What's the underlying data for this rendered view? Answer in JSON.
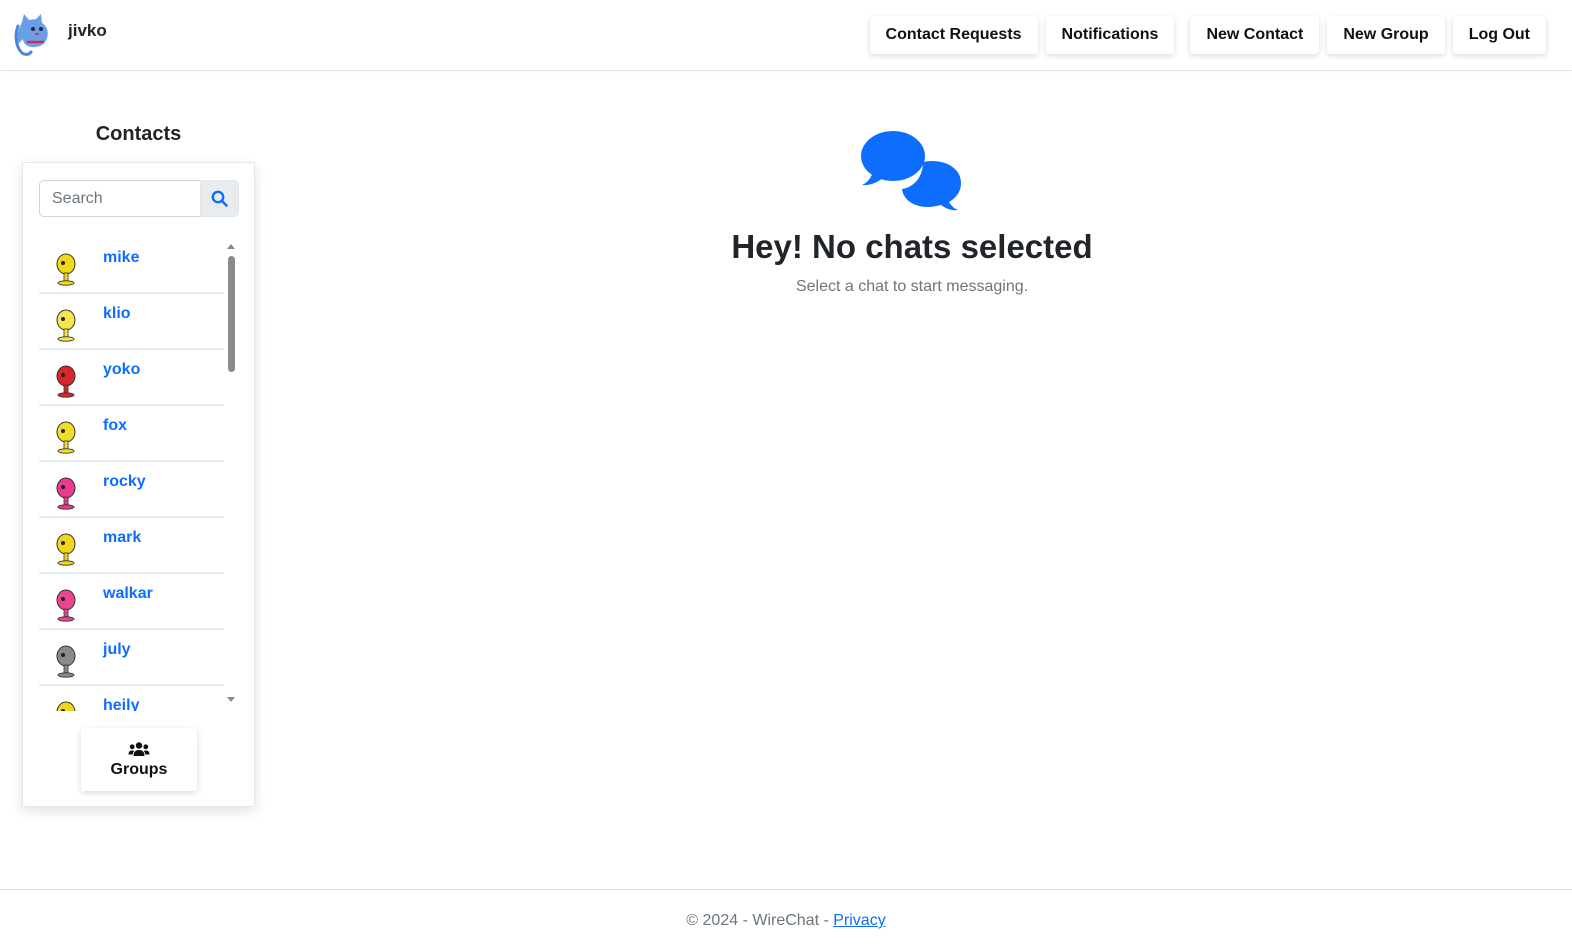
{
  "header": {
    "username": "jivko",
    "logo_icon": "blue-cat-icon",
    "nav": [
      {
        "label": "Contact Requests"
      },
      {
        "label": "Notifications"
      },
      {
        "label": "New Contact"
      },
      {
        "label": "New Group"
      },
      {
        "label": "Log Out"
      }
    ]
  },
  "sidebar": {
    "title": "Contacts",
    "search": {
      "placeholder": "Search",
      "value": "",
      "icon": "search-icon"
    },
    "contacts": [
      {
        "name": "mike",
        "avatar_icon": "yellow-robot-avatar-icon",
        "avatar_color": "#f2d81a"
      },
      {
        "name": "klio",
        "avatar_icon": "yellow-robot-avatar-icon",
        "avatar_color": "#f5e64a"
      },
      {
        "name": "yoko",
        "avatar_icon": "red-robot-avatar-icon",
        "avatar_color": "#d9262b"
      },
      {
        "name": "fox",
        "avatar_icon": "yellow-robot-avatar-icon",
        "avatar_color": "#f2dc2a"
      },
      {
        "name": "rocky",
        "avatar_icon": "pink-robot-avatar-icon",
        "avatar_color": "#e93a8e"
      },
      {
        "name": "mark",
        "avatar_icon": "yellow-robot-avatar-icon",
        "avatar_color": "#f0d51c"
      },
      {
        "name": "walkar",
        "avatar_icon": "pink-robot-avatar-icon",
        "avatar_color": "#ea4590"
      },
      {
        "name": "july",
        "avatar_icon": "gray-robot-avatar-icon",
        "avatar_color": "#8a8a8a"
      },
      {
        "name": "heily",
        "avatar_icon": "yellow-robot-avatar-icon",
        "avatar_color": "#f2d81a"
      }
    ],
    "groups_button": {
      "label": "Groups",
      "icon": "users-icon"
    }
  },
  "main": {
    "icon": "chat-bubbles-icon",
    "icon_color": "#0d6efd",
    "title": "Hey! No chats selected",
    "subtitle": "Select a chat to start messaging."
  },
  "footer": {
    "text": "© 2024 - WireChat - ",
    "link_label": "Privacy"
  },
  "colors": {
    "accent": "#0d6efd",
    "text": "#212529",
    "muted": "#6c757d"
  }
}
